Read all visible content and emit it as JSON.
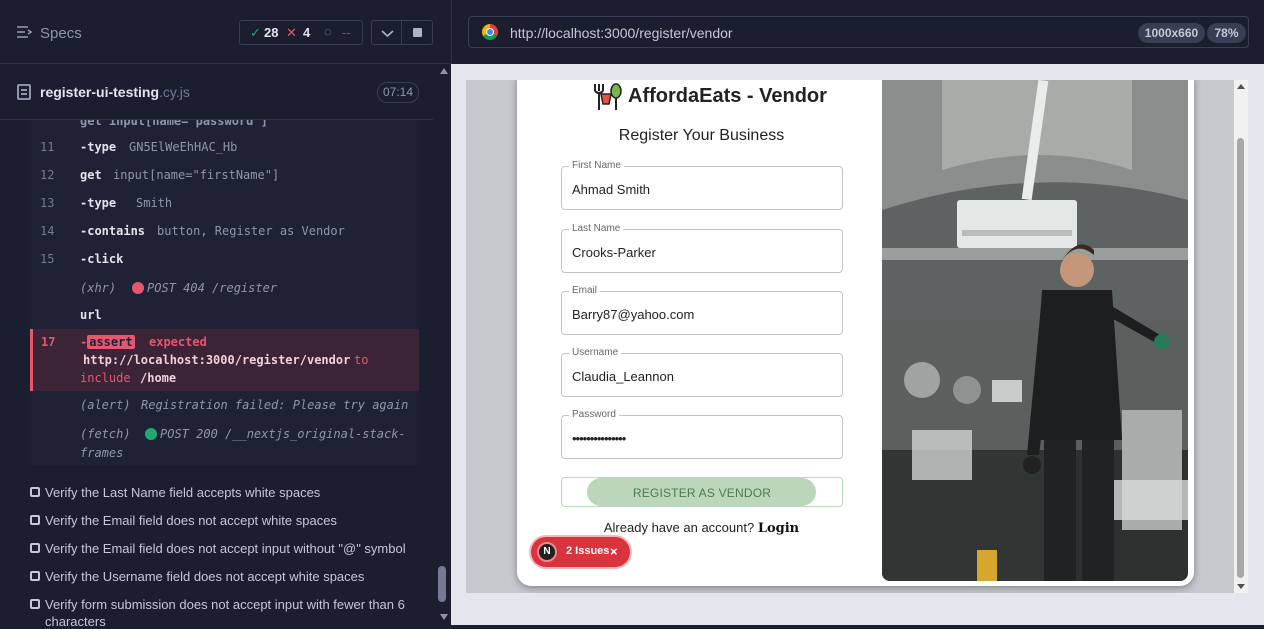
{
  "reporter": {
    "specs_label": "Specs",
    "passed": "28",
    "failed": "4",
    "pending": "--",
    "spec_file": "register-ui-testing",
    "spec_ext": ".cy.js",
    "duration": "07:14"
  },
  "command_log": [
    {
      "num": "11",
      "cmd": "-type",
      "arg": "GN5ElWeEhHAC_Hb"
    },
    {
      "num": "12",
      "cmd": "get",
      "arg": "input[name=\"firstName\"]"
    },
    {
      "num": "13",
      "cmd": "-type",
      "arg": "Smith"
    },
    {
      "num": "14",
      "cmd": "-contains",
      "arg": "button, Register as Vendor"
    },
    {
      "num": "15",
      "cmd": "-click",
      "arg": ""
    },
    {
      "num": "",
      "cmd": "(xhr)",
      "arg": "POST 404 /register"
    },
    {
      "num": "",
      "cmd": "url",
      "arg": ""
    }
  ],
  "assertion": {
    "num": "17",
    "badge": "assert",
    "expected": "expected",
    "url": "http://localhost:3000/register/vendor",
    "to": "to",
    "include": "include",
    "path": "/home"
  },
  "alert_row": {
    "cmd": "(alert)",
    "text": "Registration failed: Please try again"
  },
  "fetch_row": {
    "cmd": "(fetch)",
    "text": "POST 200 /__nextjs_original-stack-",
    "text2": "frames"
  },
  "tests": [
    "Verify the Last Name field accepts white spaces",
    "Verify the Email field does not accept white spaces",
    "Verify the Email field does not accept input without \"@\" symbol",
    "Verify the Username field does not accept white spaces",
    "Verify form submission does not accept input with fewer than 6",
    "characters"
  ],
  "browser": {
    "url": "http://localhost:3000/register/vendor",
    "viewport": "1000x660",
    "zoom": "78%"
  },
  "app": {
    "brand": "AffordaEats - Vendor",
    "subtitle": "Register Your Business",
    "fields": [
      {
        "label": "First Name",
        "value": "Ahmad Smith"
      },
      {
        "label": "Last Name",
        "value": "Crooks-Parker"
      },
      {
        "label": "Email",
        "value": "Barry87@yahoo.com"
      },
      {
        "label": "Username",
        "value": "Claudia_Leannon"
      },
      {
        "label": "Password",
        "value": "•••••••••••••••"
      }
    ],
    "submit_label": "REGISTER AS VENDOR",
    "login_prompt": "Already have an account?",
    "login_link": "Login",
    "issues_badge": "N",
    "issues_label": "2 Issues"
  },
  "colors": {
    "pass": "#1fa971",
    "fail": "#e45770",
    "brand_green": "#4f7a4f"
  }
}
